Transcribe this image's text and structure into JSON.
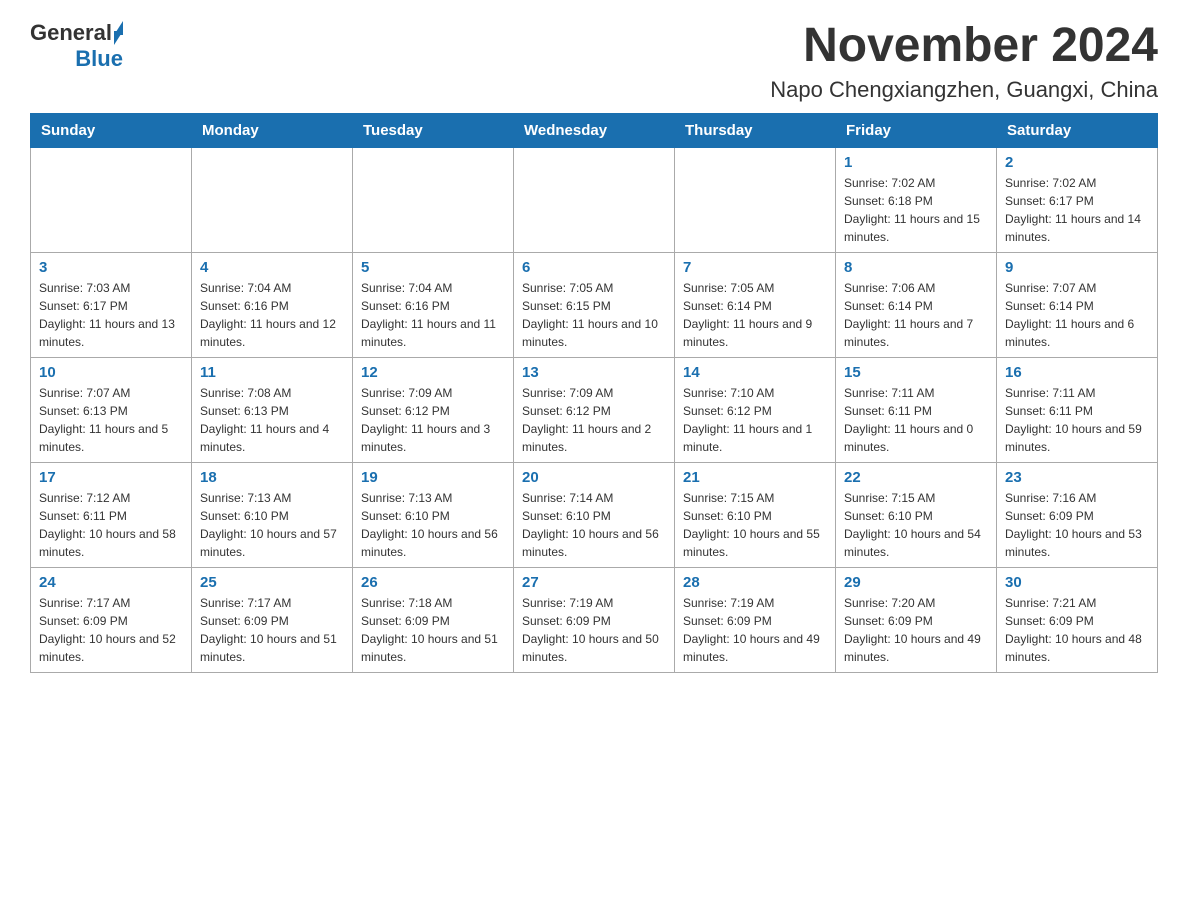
{
  "header": {
    "logo_general": "General",
    "logo_blue": "Blue",
    "title": "November 2024",
    "subtitle": "Napo Chengxiangzhen, Guangxi, China"
  },
  "weekdays": [
    "Sunday",
    "Monday",
    "Tuesday",
    "Wednesday",
    "Thursday",
    "Friday",
    "Saturday"
  ],
  "weeks": [
    [
      {
        "day": "",
        "info": ""
      },
      {
        "day": "",
        "info": ""
      },
      {
        "day": "",
        "info": ""
      },
      {
        "day": "",
        "info": ""
      },
      {
        "day": "",
        "info": ""
      },
      {
        "day": "1",
        "info": "Sunrise: 7:02 AM\nSunset: 6:18 PM\nDaylight: 11 hours and 15 minutes."
      },
      {
        "day": "2",
        "info": "Sunrise: 7:02 AM\nSunset: 6:17 PM\nDaylight: 11 hours and 14 minutes."
      }
    ],
    [
      {
        "day": "3",
        "info": "Sunrise: 7:03 AM\nSunset: 6:17 PM\nDaylight: 11 hours and 13 minutes."
      },
      {
        "day": "4",
        "info": "Sunrise: 7:04 AM\nSunset: 6:16 PM\nDaylight: 11 hours and 12 minutes."
      },
      {
        "day": "5",
        "info": "Sunrise: 7:04 AM\nSunset: 6:16 PM\nDaylight: 11 hours and 11 minutes."
      },
      {
        "day": "6",
        "info": "Sunrise: 7:05 AM\nSunset: 6:15 PM\nDaylight: 11 hours and 10 minutes."
      },
      {
        "day": "7",
        "info": "Sunrise: 7:05 AM\nSunset: 6:14 PM\nDaylight: 11 hours and 9 minutes."
      },
      {
        "day": "8",
        "info": "Sunrise: 7:06 AM\nSunset: 6:14 PM\nDaylight: 11 hours and 7 minutes."
      },
      {
        "day": "9",
        "info": "Sunrise: 7:07 AM\nSunset: 6:14 PM\nDaylight: 11 hours and 6 minutes."
      }
    ],
    [
      {
        "day": "10",
        "info": "Sunrise: 7:07 AM\nSunset: 6:13 PM\nDaylight: 11 hours and 5 minutes."
      },
      {
        "day": "11",
        "info": "Sunrise: 7:08 AM\nSunset: 6:13 PM\nDaylight: 11 hours and 4 minutes."
      },
      {
        "day": "12",
        "info": "Sunrise: 7:09 AM\nSunset: 6:12 PM\nDaylight: 11 hours and 3 minutes."
      },
      {
        "day": "13",
        "info": "Sunrise: 7:09 AM\nSunset: 6:12 PM\nDaylight: 11 hours and 2 minutes."
      },
      {
        "day": "14",
        "info": "Sunrise: 7:10 AM\nSunset: 6:12 PM\nDaylight: 11 hours and 1 minute."
      },
      {
        "day": "15",
        "info": "Sunrise: 7:11 AM\nSunset: 6:11 PM\nDaylight: 11 hours and 0 minutes."
      },
      {
        "day": "16",
        "info": "Sunrise: 7:11 AM\nSunset: 6:11 PM\nDaylight: 10 hours and 59 minutes."
      }
    ],
    [
      {
        "day": "17",
        "info": "Sunrise: 7:12 AM\nSunset: 6:11 PM\nDaylight: 10 hours and 58 minutes."
      },
      {
        "day": "18",
        "info": "Sunrise: 7:13 AM\nSunset: 6:10 PM\nDaylight: 10 hours and 57 minutes."
      },
      {
        "day": "19",
        "info": "Sunrise: 7:13 AM\nSunset: 6:10 PM\nDaylight: 10 hours and 56 minutes."
      },
      {
        "day": "20",
        "info": "Sunrise: 7:14 AM\nSunset: 6:10 PM\nDaylight: 10 hours and 56 minutes."
      },
      {
        "day": "21",
        "info": "Sunrise: 7:15 AM\nSunset: 6:10 PM\nDaylight: 10 hours and 55 minutes."
      },
      {
        "day": "22",
        "info": "Sunrise: 7:15 AM\nSunset: 6:10 PM\nDaylight: 10 hours and 54 minutes."
      },
      {
        "day": "23",
        "info": "Sunrise: 7:16 AM\nSunset: 6:09 PM\nDaylight: 10 hours and 53 minutes."
      }
    ],
    [
      {
        "day": "24",
        "info": "Sunrise: 7:17 AM\nSunset: 6:09 PM\nDaylight: 10 hours and 52 minutes."
      },
      {
        "day": "25",
        "info": "Sunrise: 7:17 AM\nSunset: 6:09 PM\nDaylight: 10 hours and 51 minutes."
      },
      {
        "day": "26",
        "info": "Sunrise: 7:18 AM\nSunset: 6:09 PM\nDaylight: 10 hours and 51 minutes."
      },
      {
        "day": "27",
        "info": "Sunrise: 7:19 AM\nSunset: 6:09 PM\nDaylight: 10 hours and 50 minutes."
      },
      {
        "day": "28",
        "info": "Sunrise: 7:19 AM\nSunset: 6:09 PM\nDaylight: 10 hours and 49 minutes."
      },
      {
        "day": "29",
        "info": "Sunrise: 7:20 AM\nSunset: 6:09 PM\nDaylight: 10 hours and 49 minutes."
      },
      {
        "day": "30",
        "info": "Sunrise: 7:21 AM\nSunset: 6:09 PM\nDaylight: 10 hours and 48 minutes."
      }
    ]
  ]
}
